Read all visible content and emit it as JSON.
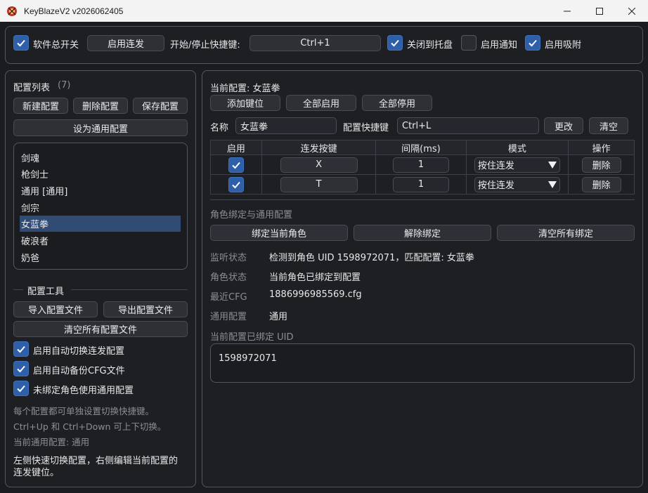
{
  "window": {
    "title": "KeyBlazeV2 v2026062405"
  },
  "toolbar": {
    "master_switch_label": "软件总开关",
    "master_switch_checked": true,
    "enable_rapid_label": "启用连发",
    "hotkey_label": "开始/停止快捷键:",
    "hotkey_value": "Ctrl+1",
    "close_to_tray_label": "关闭到托盘",
    "close_to_tray_checked": true,
    "enable_notify_label": "启用通知",
    "enable_notify_checked": false,
    "enable_snap_label": "启用吸附",
    "enable_snap_checked": true
  },
  "left": {
    "list_title": "配置列表",
    "list_count": "(7)",
    "new_config": "新建配置",
    "delete_config": "删除配置",
    "save_config": "保存配置",
    "set_general": "设为通用配置",
    "configs": [
      "剑魂",
      "枪剑士",
      "通用 [通用]",
      "剑宗",
      "女蓝拳",
      "破浪者",
      "奶爸"
    ],
    "selected_index": 4,
    "tools_title": "配置工具",
    "import_config": "导入配置文件",
    "export_config": "导出配置文件",
    "clear_all_configs": "清空所有配置文件",
    "options": [
      {
        "label": "启用自动切换连发配置",
        "checked": true
      },
      {
        "label": "启用自动备份CFG文件",
        "checked": true
      },
      {
        "label": "未绑定角色使用通用配置",
        "checked": true
      }
    ],
    "hint1": "每个配置都可单独设置切换快捷键。",
    "hint2": "Ctrl+Up 和 Ctrl+Down 可上下切换。",
    "hint3": "当前通用配置: 通用",
    "hint4a": "左侧快速切换配置，右侧编辑当前配置的",
    "hint4b": "连发键位。"
  },
  "right": {
    "current_config": "当前配置: 女蓝拳",
    "add_key": "添加键位",
    "enable_all": "全部启用",
    "disable_all": "全部停用",
    "name_label": "名称",
    "name_value": "女蓝拳",
    "config_hotkey_label": "配置快捷键",
    "config_hotkey_value": "Ctrl+L",
    "change": "更改",
    "clear": "清空",
    "table": {
      "headers": [
        "启用",
        "连发按键",
        "间隔(ms)",
        "模式",
        "操作"
      ],
      "rows": [
        {
          "enabled": true,
          "key": "X",
          "interval": "1",
          "mode": "按住连发",
          "action": "删除"
        },
        {
          "enabled": true,
          "key": "T",
          "interval": "1",
          "mode": "按住连发",
          "action": "删除"
        }
      ]
    },
    "binding_title": "角色绑定与通用配置",
    "bind_current": "绑定当前角色",
    "unbind": "解除绑定",
    "clear_bindings": "清空所有绑定",
    "status": [
      {
        "label": "监听状态",
        "value": "检测到角色 UID 1598972071，匹配配置: 女蓝拳"
      },
      {
        "label": "角色状态",
        "value": "当前角色已绑定到配置"
      },
      {
        "label": "最近CFG",
        "value": "1886996985569.cfg"
      },
      {
        "label": "通用配置",
        "value": "通用"
      }
    ],
    "bound_uid_label": "当前配置已绑定 UID",
    "bound_uid_text": "1598972071"
  },
  "colors": {
    "accent": "#2f5fa8",
    "selection": "#304c74",
    "background": "#1b1c20"
  }
}
